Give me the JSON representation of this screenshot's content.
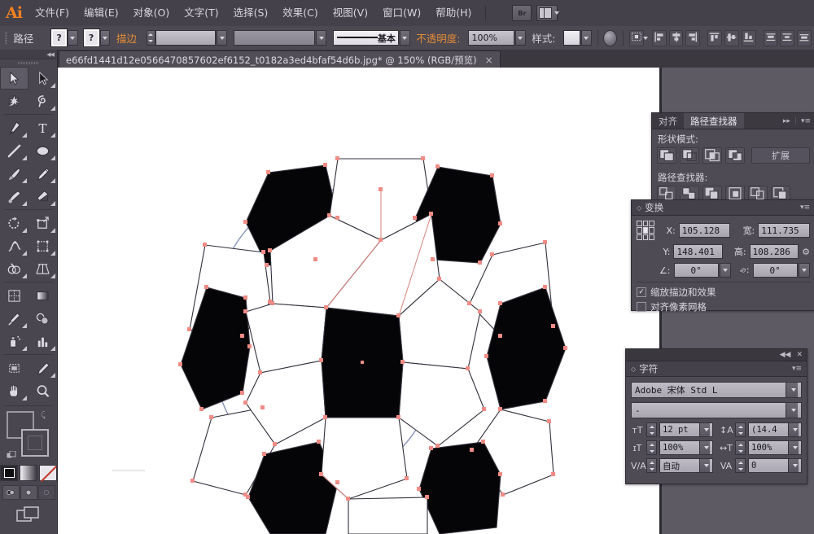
{
  "app": {
    "logo": "Ai",
    "accent_orange": "#f58220",
    "ui_bg": "#45414a",
    "panel_bg": "#4f4b55"
  },
  "menubar": {
    "items": [
      {
        "label": "文件(F)"
      },
      {
        "label": "编辑(E)"
      },
      {
        "label": "对象(O)"
      },
      {
        "label": "文字(T)"
      },
      {
        "label": "选择(S)"
      },
      {
        "label": "效果(C)"
      },
      {
        "label": "视图(V)"
      },
      {
        "label": "窗口(W)"
      },
      {
        "label": "帮助(H)"
      }
    ],
    "bridge_label": "Br"
  },
  "controlbar": {
    "context_label": "路径",
    "fill_value": "?",
    "stroke_swatch_value": "?",
    "stroke_label": "描边",
    "stroke_weight": "",
    "stroke_profile": "",
    "brush_label": "基本",
    "opacity_label": "不透明度:",
    "opacity_value": "100%",
    "style_label": "样式:"
  },
  "document": {
    "tab_title": "e66fd1441d12e0566470857602ef6152_t0182a3ed4bfaf54d6b.jpg*  @  150%  (RGB/预览)",
    "close_glyph": "×",
    "zoom": "150%",
    "color_mode": "RGB/预览"
  },
  "toolbox": {
    "tools": [
      {
        "name": "selection-tool",
        "selected": true
      },
      {
        "name": "direct-selection-tool",
        "selected": false
      },
      {
        "name": "magic-wand-tool",
        "selected": false
      },
      {
        "name": "lasso-tool",
        "selected": false
      },
      {
        "name": "pen-tool",
        "selected": false
      },
      {
        "name": "type-tool",
        "selected": false
      },
      {
        "name": "line-segment-tool",
        "selected": false
      },
      {
        "name": "ellipse-tool",
        "selected": false
      },
      {
        "name": "paintbrush-tool",
        "selected": false
      },
      {
        "name": "pencil-tool",
        "selected": false
      },
      {
        "name": "blob-brush-tool",
        "selected": false
      },
      {
        "name": "eraser-tool",
        "selected": false
      },
      {
        "name": "rotate-tool",
        "selected": false
      },
      {
        "name": "scale-tool",
        "selected": false
      },
      {
        "name": "width-tool",
        "selected": false
      },
      {
        "name": "free-transform-tool",
        "selected": false
      },
      {
        "name": "shape-builder-tool",
        "selected": false
      },
      {
        "name": "perspective-grid-tool",
        "selected": false
      },
      {
        "name": "mesh-tool",
        "selected": false
      },
      {
        "name": "gradient-tool",
        "selected": false
      },
      {
        "name": "eyedropper-tool",
        "selected": false
      },
      {
        "name": "blend-tool",
        "selected": false
      },
      {
        "name": "symbol-sprayer-tool",
        "selected": false
      },
      {
        "name": "column-graph-tool",
        "selected": false
      },
      {
        "name": "artboard-tool",
        "selected": false
      },
      {
        "name": "slice-tool",
        "selected": false
      },
      {
        "name": "hand-tool",
        "selected": false
      },
      {
        "name": "zoom-tool",
        "selected": false
      }
    ]
  },
  "pathfinder_panel": {
    "tabs": [
      {
        "label": "对齐",
        "active": false
      },
      {
        "label": "路径查找器",
        "active": true
      }
    ],
    "shape_modes_label": "形状模式:",
    "expand_label": "扩展",
    "pathfinders_label": "路径查找器:"
  },
  "transform_panel": {
    "title": "变换",
    "x_label": "X:",
    "x_value": "105.128",
    "w_label": "宽:",
    "w_value": "111.735",
    "y_label": "Y:",
    "y_value": "148.401",
    "h_label": "高:",
    "h_value": "108.286",
    "angle_label": "∠:",
    "angle_value": "0°",
    "shear_label": "⌮:",
    "shear_value": "0°",
    "scale_strokes_label": "缩放描边和效果",
    "scale_strokes_checked": "✓",
    "align_pixel_label": "对齐像素网格",
    "align_pixel_checked": ""
  },
  "character_panel": {
    "title": "字符",
    "font_family": "Adobe 宋体 Std L",
    "font_style": "-",
    "font_size": "12 pt",
    "leading": "(14.4",
    "vertical_scale": "100%",
    "horizontal_scale": "100%",
    "kerning": "自动",
    "tracking": "0",
    "collapse_glyph": "◀◀",
    "close_glyph": "✕"
  },
  "artwork": {
    "name": "soccer-ball-vector",
    "anchor_color": "#ef8c85",
    "guide_circle_color": "#7f8fb5",
    "fill_dark": "#050507",
    "fill_light": "#ffffff",
    "path_stroke": "#2a2733",
    "center_anchor_color": "#ef8c85"
  }
}
